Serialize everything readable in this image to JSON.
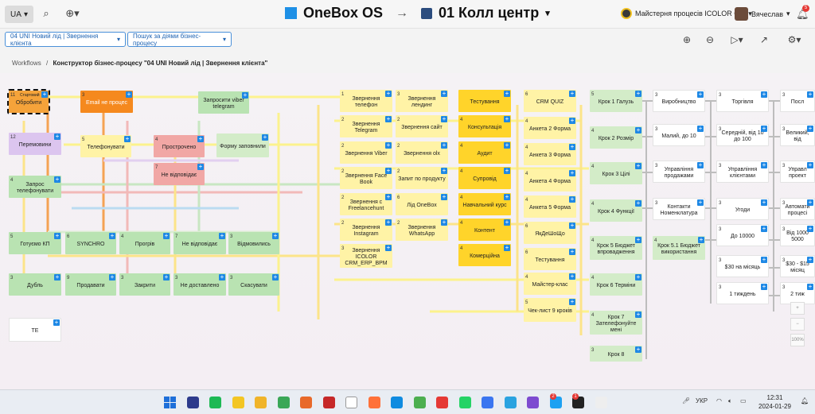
{
  "topbar": {
    "lang": "UA",
    "brand": "OneBox OS",
    "arrow": "→",
    "project": "01 Колл центр",
    "workspace": "Майстерня процесів ICOLOR C...",
    "user": "Вячеслав",
    "notifications": "5"
  },
  "toolbar": {
    "process_select": "04 UNI Новий лід | Звернення клієнта",
    "action_select": "Пошук за діями бізнес-процесу"
  },
  "breadcrumbs": {
    "root": "Workflows",
    "sep": "/",
    "current": "Конструктор бізнес-процесу \"04 UNI Новий лід | Звернення клієнта\""
  },
  "nodes": [
    {
      "id": "n-start",
      "num": "11",
      "sub": "Стартовий",
      "label": "Обробити",
      "color": "start"
    },
    {
      "id": "n-email",
      "num": "3",
      "label": "Email не процес",
      "color": "orange"
    },
    {
      "id": "n-viber",
      "num": "",
      "label": "Запросити viber telegram",
      "color": "green"
    },
    {
      "id": "n-peremov",
      "num": "12",
      "label": "Перемовини",
      "color": "violet"
    },
    {
      "id": "n-telef",
      "num": "5",
      "label": "Телефонувати",
      "color": "yellow-l"
    },
    {
      "id": "n-prostr",
      "num": "4",
      "label": "Прострочено",
      "color": "pink"
    },
    {
      "id": "n-forma",
      "num": "",
      "label": "Форму заповнили",
      "color": "green-l"
    },
    {
      "id": "n-nevidp",
      "num": "7",
      "label": "Не відповідає",
      "color": "pink"
    },
    {
      "id": "n-zapros",
      "num": "4",
      "label": "Запрос телефонувати",
      "color": "green"
    },
    {
      "id": "n-gotove",
      "num": "5",
      "label": "Готуємо КП",
      "color": "green"
    },
    {
      "id": "n-synchro",
      "num": "6",
      "label": "SYNCHRO",
      "color": "green"
    },
    {
      "id": "n-progriv",
      "num": "4",
      "label": "Прогрів",
      "color": "green"
    },
    {
      "id": "n-nevidp2",
      "num": "7",
      "label": "Не відповідає",
      "color": "green"
    },
    {
      "id": "n-vidmov",
      "num": "3",
      "label": "Відмовились",
      "color": "green"
    },
    {
      "id": "n-dubl",
      "num": "3",
      "label": "Дубль",
      "color": "green"
    },
    {
      "id": "n-prodav",
      "num": "9",
      "label": "Продавати",
      "color": "green"
    },
    {
      "id": "n-zakr",
      "num": "3",
      "label": "Закрити",
      "color": "green"
    },
    {
      "id": "n-nedost",
      "num": "3",
      "label": "Не доставлено",
      "color": "green"
    },
    {
      "id": "n-skas",
      "num": "3",
      "label": "Скасувати",
      "color": "green"
    },
    {
      "id": "n-te",
      "num": "",
      "label": "ТЕ",
      "color": "white"
    },
    {
      "id": "c1-1",
      "num": "1",
      "label": "Звернення телефон",
      "color": "yellow-l"
    },
    {
      "id": "c1-2",
      "num": "2",
      "label": "Звернення Telegram",
      "color": "yellow-l"
    },
    {
      "id": "c1-3",
      "num": "2",
      "label": "Звернення Viber",
      "color": "yellow-l"
    },
    {
      "id": "c1-4",
      "num": "2",
      "label": "Звернення Face Book",
      "color": "yellow-l"
    },
    {
      "id": "c1-5",
      "num": "2",
      "label": "Звернення с Freelancehunt",
      "color": "yellow-l"
    },
    {
      "id": "c1-6",
      "num": "2",
      "label": "Звернення Instagram",
      "color": "yellow-l"
    },
    {
      "id": "c1-7",
      "num": "3",
      "label": "Звернення ICOLOR CRM_ERP_BPM",
      "color": "yellow-l"
    },
    {
      "id": "c2-1",
      "num": "3",
      "label": "Звернення лендинг",
      "color": "yellow-l"
    },
    {
      "id": "c2-2",
      "num": "2",
      "label": "Звернення сайт",
      "color": "yellow-l"
    },
    {
      "id": "c2-3",
      "num": "2",
      "label": "Звернення olx",
      "color": "yellow-l"
    },
    {
      "id": "c2-4",
      "num": "2",
      "label": "Запит по продукту",
      "color": "yellow-l"
    },
    {
      "id": "c2-5",
      "num": "6",
      "label": "Лід OneBox",
      "color": "yellow-l"
    },
    {
      "id": "c2-6",
      "num": "2",
      "label": "Звернення WhatsApp",
      "color": "yellow-l"
    },
    {
      "id": "c3-1",
      "num": "",
      "label": "Тестування",
      "color": "yellow-d"
    },
    {
      "id": "c3-2",
      "num": "4",
      "label": "Консультація",
      "color": "yellow-d"
    },
    {
      "id": "c3-3",
      "num": "4",
      "label": "Аудит",
      "color": "yellow-d"
    },
    {
      "id": "c3-4",
      "num": "4",
      "label": "Супровід",
      "color": "yellow-d"
    },
    {
      "id": "c3-5",
      "num": "4",
      "label": "Навчальний курс",
      "color": "yellow-d"
    },
    {
      "id": "c3-6",
      "num": "4",
      "label": "Контент",
      "color": "yellow-d"
    },
    {
      "id": "c3-7",
      "num": "4",
      "label": "Комерційна",
      "color": "yellow-d"
    },
    {
      "id": "c4-1",
      "num": "6",
      "label": "CRM QUIZ",
      "color": "yellow-l"
    },
    {
      "id": "c4-2",
      "num": "4",
      "label": "Анкета 2 Форма",
      "color": "yellow-l"
    },
    {
      "id": "c4-3",
      "num": "4",
      "label": "Анкета 3 Форма",
      "color": "yellow-l"
    },
    {
      "id": "c4-4",
      "num": "4",
      "label": "Анкета 4 Форма",
      "color": "yellow-l"
    },
    {
      "id": "c4-5",
      "num": "4",
      "label": "Анкета 5 Форма",
      "color": "yellow-l"
    },
    {
      "id": "c4-6",
      "num": "6",
      "label": "ЯкДеШоЩо",
      "color": "yellow-l"
    },
    {
      "id": "c4-7",
      "num": "6",
      "label": "Тестування",
      "color": "yellow-l"
    },
    {
      "id": "c4-8",
      "num": "4",
      "label": "Майстер-клас",
      "color": "yellow-l"
    },
    {
      "id": "c4-9",
      "num": "5",
      "label": "Чек-лист 9 кроків",
      "color": "yellow-l"
    },
    {
      "id": "c5-1",
      "num": "5",
      "label": "Крок 1 Галузь",
      "color": "green-l"
    },
    {
      "id": "c5-2",
      "num": "4",
      "label": "Крок 2 Розмір",
      "color": "green-l"
    },
    {
      "id": "c5-3",
      "num": "4",
      "label": "Крок 3 Цілі",
      "color": "green-l"
    },
    {
      "id": "c5-4",
      "num": "4",
      "label": "Крок 4 Функції",
      "color": "green-l"
    },
    {
      "id": "c5-5",
      "num": "4",
      "label": "Крок 5 Бюджет впровадження",
      "color": "green-l"
    },
    {
      "id": "c5-6",
      "num": "4",
      "label": "Крок 6 Терміни",
      "color": "green-l"
    },
    {
      "id": "c5-7",
      "num": "4",
      "label": "Крок 7 Зателефонуйте мені",
      "color": "green-l"
    },
    {
      "id": "c5-8",
      "num": "3",
      "label": "Крок 8",
      "color": "green-l"
    },
    {
      "id": "c6-1",
      "num": "3",
      "label": "Виробництво",
      "color": "white"
    },
    {
      "id": "c6-2",
      "num": "3",
      "label": "Малий, до 10",
      "color": "white"
    },
    {
      "id": "c6-3",
      "num": "3",
      "label": "Управління продажами",
      "color": "white"
    },
    {
      "id": "c6-4",
      "num": "3",
      "label": "Контакти Номенклатура",
      "color": "white"
    },
    {
      "id": "c6-5",
      "num": "4",
      "label": "Крок 5.1 Бюджет використання",
      "color": "green-l"
    },
    {
      "id": "c7-1",
      "num": "3",
      "label": "Торгівля",
      "color": "white"
    },
    {
      "id": "c7-2",
      "num": "3",
      "label": "Середній, від 10 до 100",
      "color": "white"
    },
    {
      "id": "c7-3",
      "num": "3",
      "label": "Управління клієнтами",
      "color": "white"
    },
    {
      "id": "c7-4",
      "num": "3",
      "label": "Угоди",
      "color": "white"
    },
    {
      "id": "c7-5",
      "num": "3",
      "label": "До 10000",
      "color": "white"
    },
    {
      "id": "c7-6",
      "num": "3",
      "label": "$30 на місяць",
      "color": "white"
    },
    {
      "id": "c7-7",
      "num": "3",
      "label": "1 тиждень",
      "color": "white"
    },
    {
      "id": "c8-1",
      "num": "3",
      "label": "Посл",
      "color": "white"
    },
    {
      "id": "c8-2",
      "num": "3",
      "label": "Великий, від",
      "color": "white"
    },
    {
      "id": "c8-3",
      "num": "3",
      "label": "Управл проект",
      "color": "white"
    },
    {
      "id": "c8-4",
      "num": "3",
      "label": "Автомати процесі",
      "color": "white"
    },
    {
      "id": "c8-5",
      "num": "3",
      "label": "Від 1000 5000",
      "color": "white"
    },
    {
      "id": "c8-6",
      "num": "3",
      "label": "$30 - $15 місяц",
      "color": "white"
    },
    {
      "id": "c8-7",
      "num": "3",
      "label": "2 тиж",
      "color": "white"
    }
  ],
  "zoom": {
    "in": "+",
    "out": "−",
    "fit": "100%"
  },
  "taskbar": {
    "lang": "УКР",
    "time": "12:31",
    "date": "2024-01-29",
    "apps": [
      "start",
      "ps",
      "spotify",
      "files",
      "explorer",
      "green-app",
      "orange-app",
      "red-app",
      "doc",
      "firefox",
      "edge",
      "chrome",
      "opera",
      "whatsapp",
      "signal",
      "telegram",
      "viber",
      "bird",
      "obs",
      "wolf"
    ],
    "badge_tg": "2",
    "badge_viber": "1"
  },
  "colors": {
    "accent": "#1e88e5",
    "brand": "#1e90e6"
  }
}
